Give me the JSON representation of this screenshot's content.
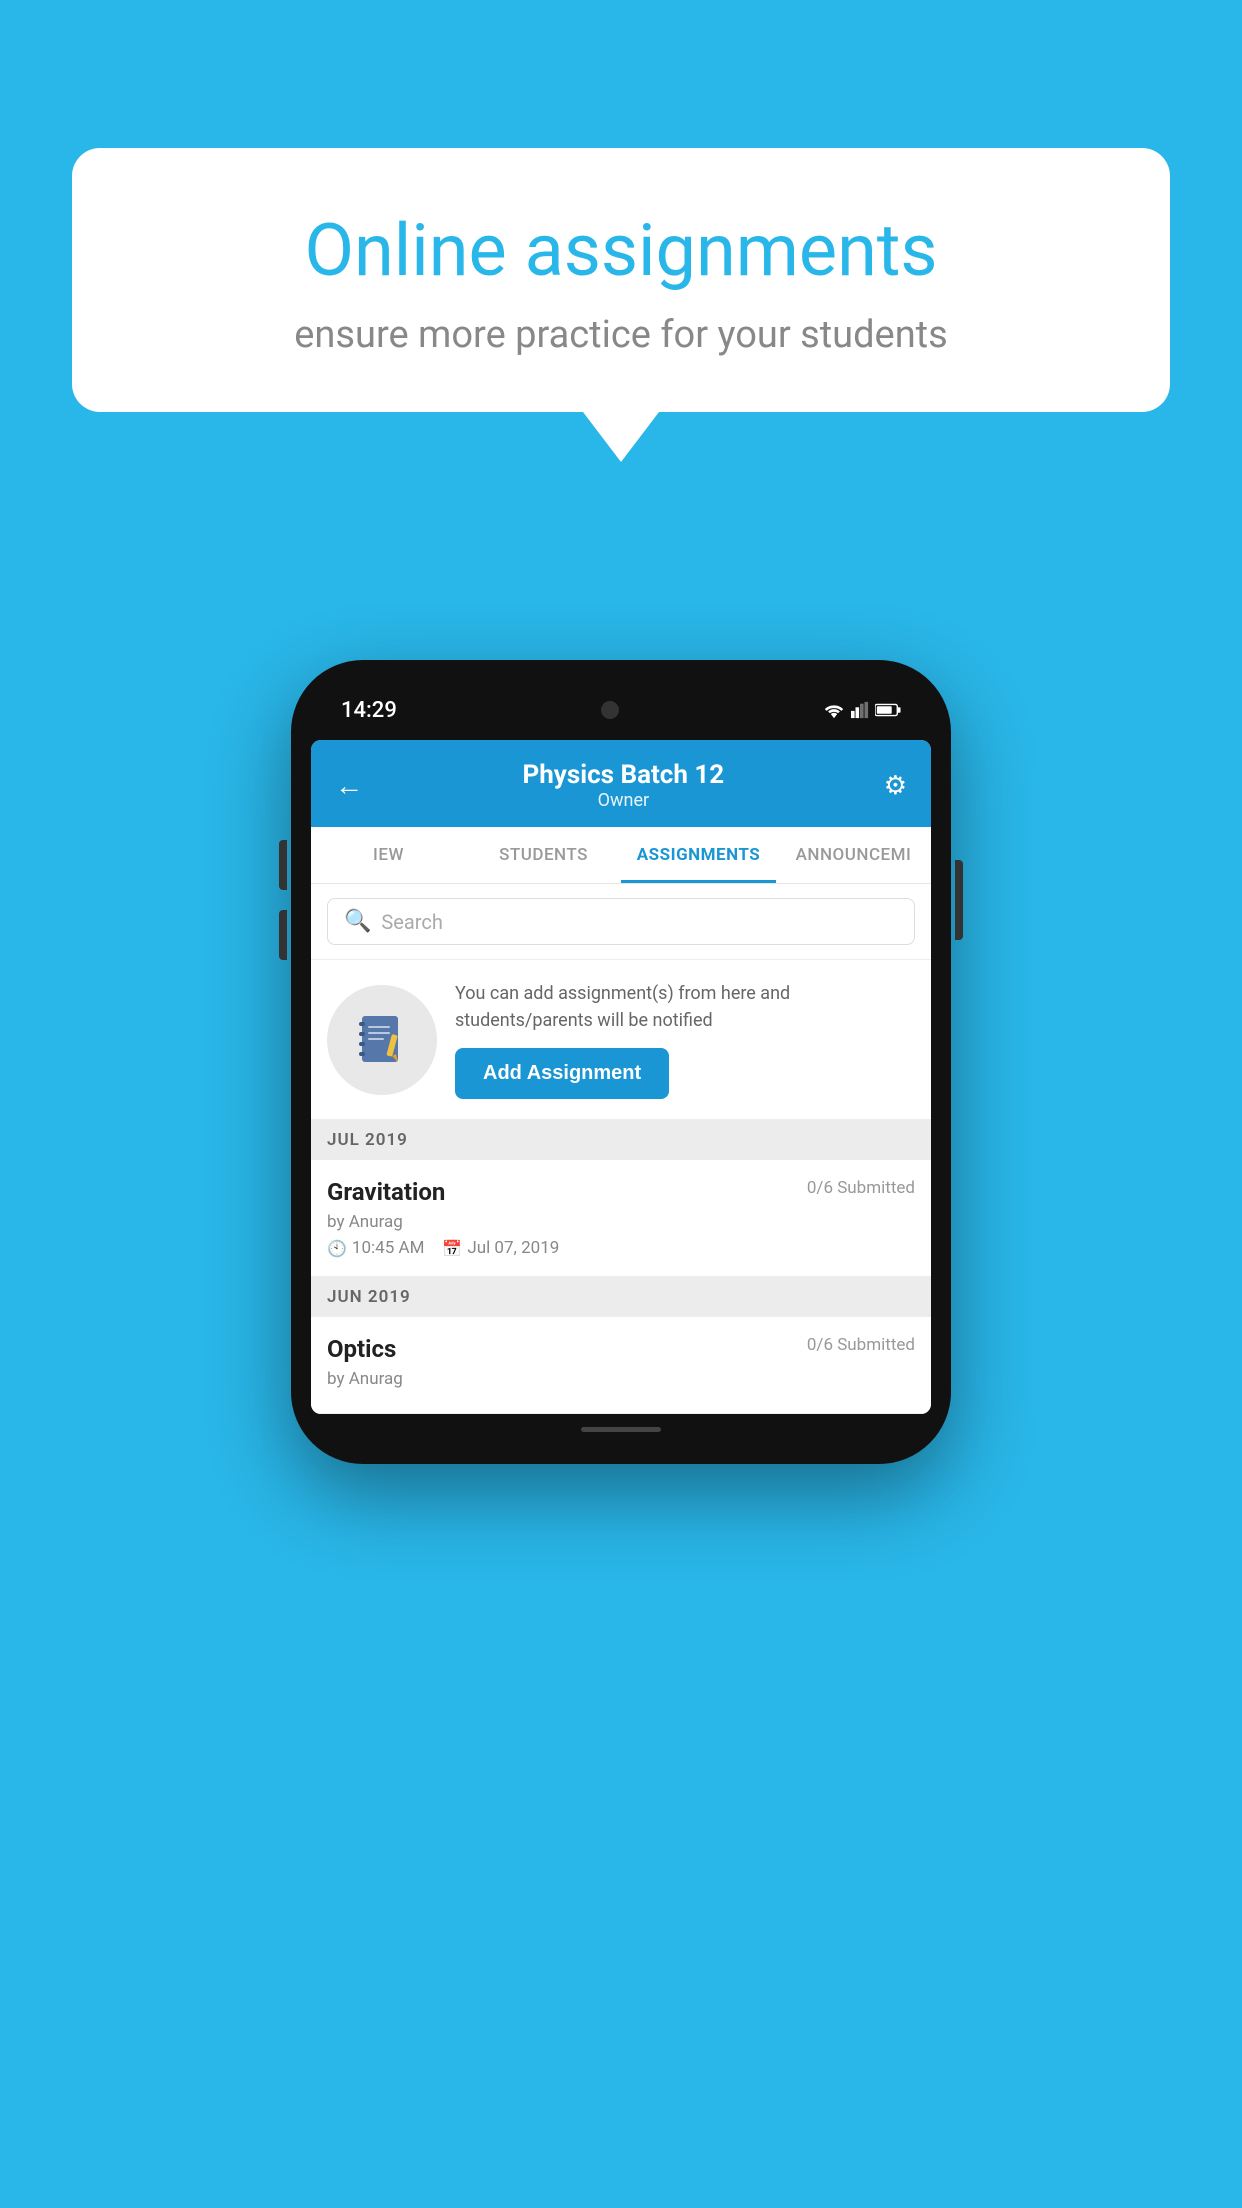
{
  "background_color": "#29b6e8",
  "speech_bubble": {
    "title": "Online assignments",
    "subtitle": "ensure more practice for your students"
  },
  "phone": {
    "status_bar": {
      "time": "14:29"
    },
    "header": {
      "title": "Physics Batch 12",
      "subtitle": "Owner",
      "back_label": "←",
      "settings_label": "⚙"
    },
    "tabs": [
      {
        "label": "IEW",
        "active": false
      },
      {
        "label": "STUDENTS",
        "active": false
      },
      {
        "label": "ASSIGNMENTS",
        "active": true
      },
      {
        "label": "ANNOUNCEMI",
        "active": false
      }
    ],
    "search": {
      "placeholder": "Search"
    },
    "promo": {
      "description": "You can add assignment(s) from here and students/parents will be notified",
      "button_label": "Add Assignment"
    },
    "sections": [
      {
        "month_label": "JUL 2019",
        "assignments": [
          {
            "title": "Gravitation",
            "submitted": "0/6 Submitted",
            "author": "by Anurag",
            "time": "10:45 AM",
            "date": "Jul 07, 2019"
          }
        ]
      },
      {
        "month_label": "JUN 2019",
        "assignments": [
          {
            "title": "Optics",
            "submitted": "0/6 Submitted",
            "author": "by Anurag",
            "time": "",
            "date": ""
          }
        ]
      }
    ]
  }
}
